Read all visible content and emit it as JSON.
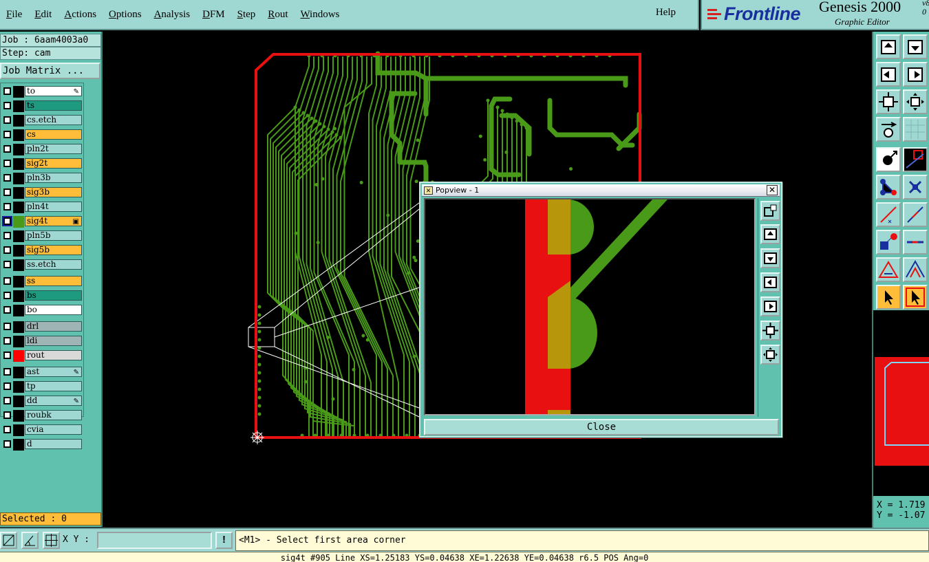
{
  "menu": {
    "items": [
      {
        "label": "File",
        "mnemonic": "F",
        "rest": "ile"
      },
      {
        "label": "Edit",
        "mnemonic": "E",
        "rest": "dit"
      },
      {
        "label": "Actions",
        "mnemonic": "A",
        "rest": "ctions"
      },
      {
        "label": "Options",
        "mnemonic": "O",
        "rest": "ptions"
      },
      {
        "label": "Analysis",
        "mnemonic": "A",
        "rest": "nalysis"
      },
      {
        "label": "DFM",
        "mnemonic": "D",
        "rest": "FM"
      },
      {
        "label": "Step",
        "mnemonic": "S",
        "rest": "tep"
      },
      {
        "label": "Rout",
        "mnemonic": "R",
        "rest": "out"
      },
      {
        "label": "Windows",
        "mnemonic": "W",
        "rest": "indows"
      }
    ],
    "help": "Help"
  },
  "brand": {
    "logo": "Frontline",
    "product": "Genesis 2000",
    "version_line1": "v8",
    "version_line2": "0",
    "subtitle": "Graphic Editor",
    "logo_color": "#1a2f9e",
    "logo_stripe_color": "#d82020"
  },
  "job": {
    "job_line": "Job : 6aam4003a0",
    "step_line": "Step: cam",
    "matrix_button": "Job Matrix ..."
  },
  "layers": [
    {
      "name": "to",
      "color": "#ffffff",
      "swatch": "#000000",
      "mark": "✎"
    },
    {
      "name": "ts",
      "color": "#1e9a80",
      "swatch": "#000000",
      "mark": ""
    },
    {
      "name": "cs.etch",
      "color": "#9fd8d2",
      "swatch": "#000000",
      "mark": ""
    },
    {
      "name": "cs",
      "color": "#ffbd3a",
      "swatch": "#000000",
      "mark": ""
    },
    {
      "name": "pln2t",
      "color": "#9fd8d2",
      "swatch": "#000000",
      "mark": ""
    },
    {
      "name": "sig2t",
      "color": "#ffbd3a",
      "swatch": "#000000",
      "mark": ""
    },
    {
      "name": "pln3b",
      "color": "#9fd8d2",
      "swatch": "#000000",
      "mark": ""
    },
    {
      "name": "sig3b",
      "color": "#ffbd3a",
      "swatch": "#000000",
      "mark": ""
    },
    {
      "name": "pln4t",
      "color": "#9fd8d2",
      "swatch": "#000000",
      "mark": ""
    },
    {
      "name": "sig4t",
      "color": "#ffbd3a",
      "swatch": "#4a9a1a",
      "mark": "▣",
      "active": true
    },
    {
      "name": "pln5b",
      "color": "#9fd8d2",
      "swatch": "#000000",
      "mark": ""
    },
    {
      "name": "sig5b",
      "color": "#ffbd3a",
      "swatch": "#000000",
      "mark": ""
    },
    {
      "name": "ss.etch",
      "color": "#9fd8d2",
      "swatch": "#000000",
      "mark": ""
    },
    {
      "name": "ss",
      "color": "#ffbd3a",
      "swatch": "#000000",
      "mark": ""
    },
    {
      "name": "bs",
      "color": "#1e9a80",
      "swatch": "#000000",
      "mark": ""
    },
    {
      "name": "bo",
      "color": "#ffffff",
      "swatch": "#000000",
      "mark": ""
    },
    {
      "name": "drl",
      "color": "#9fb4b4",
      "swatch": "#000000",
      "mark": ""
    },
    {
      "name": "ldi",
      "color": "#9fb4b4",
      "swatch": "#000000",
      "mark": ""
    },
    {
      "name": "rout",
      "color": "#d9d9d9",
      "swatch": "#ff0000",
      "mark": ""
    },
    {
      "name": "ast",
      "color": "#9fd8d2",
      "swatch": "#000000",
      "mark": "✎"
    },
    {
      "name": "tp",
      "color": "#9fd8d2",
      "swatch": "#000000",
      "mark": ""
    },
    {
      "name": "dd",
      "color": "#9fd8d2",
      "swatch": "#000000",
      "mark": "✎"
    },
    {
      "name": "roubk",
      "color": "#9fd8d2",
      "swatch": "#000000",
      "mark": ""
    },
    {
      "name": "cvia",
      "color": "#9fd8d2",
      "swatch": "#000000",
      "mark": ""
    },
    {
      "name": "d",
      "color": "#9fd8d2",
      "swatch": "#000000",
      "mark": ""
    }
  ],
  "selected": "Selected : 0",
  "popview": {
    "title": "Popview - 1",
    "close_button": "Close",
    "close_x": "✕"
  },
  "coords": {
    "x": "X = 1.719",
    "y": "Y = -1.07"
  },
  "bottom": {
    "xy_label": "X Y :",
    "xy_value": "",
    "bang": "!",
    "prompt": "<M1> - Select first area corner"
  },
  "status_line": "sig4t #905 Line XS=1.25183 YS=0.04638 XE=1.22638 YE=0.04638 r6.5 POS Ang=0",
  "colors": {
    "board_outline": "#e81010",
    "trace": "#4a9a1a",
    "copper_overlap": "#b8960c",
    "panel": "#5fc1ae",
    "menubar": "#9fd8d2"
  }
}
